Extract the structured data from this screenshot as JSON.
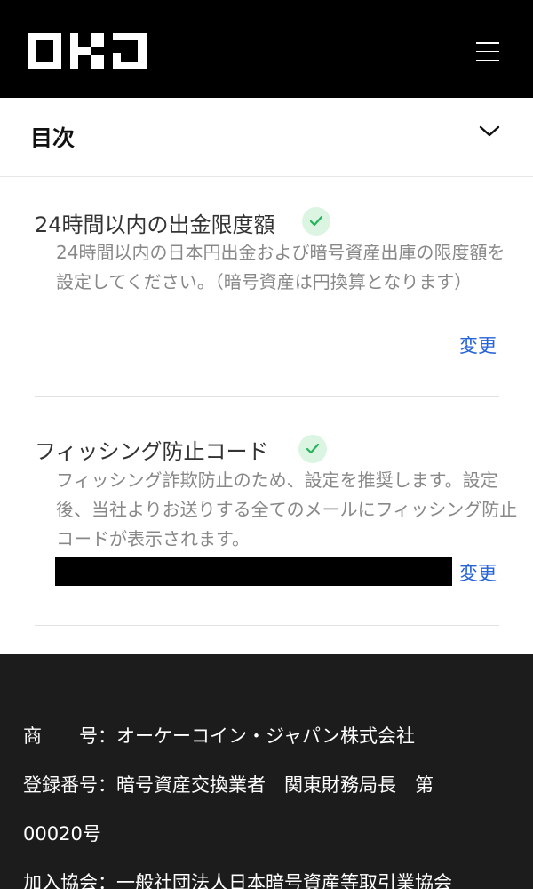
{
  "header": {
    "logo_text": "OKJ",
    "menu_icon": "hamburger-menu-icon"
  },
  "toc": {
    "title": "目次",
    "chevron_icon": "chevron-down-icon"
  },
  "sections": [
    {
      "title": "24時間以内の出金限度額",
      "status_icon": "check-icon",
      "description": "24時間以内の日本円出金および暗号資産出庫の限度額を設定してください。（暗号資産は円換算となります）",
      "action_label": "変更"
    },
    {
      "title": "フィッシング防止コード",
      "status_icon": "check-icon",
      "description": "フィッシング詐欺防止のため、設定を推奨します。設定後、当社よりお送りする全てのメールにフィッシング防止コードが表示されます。",
      "action_label": "変更"
    }
  ],
  "footer": {
    "company": "商　　号：オーケーコイン・ジャパン株式会社",
    "registration_1": "登録番号：暗号資産交換業者　関東財務局長　第",
    "registration_2": "00020号",
    "association": "加入協会：一般社団法人日本暗号資産等取引業協会"
  },
  "colors": {
    "header_bg": "#000000",
    "footer_bg": "#1c1c1c",
    "link": "#2563d9",
    "check_bg": "#dcf5e2",
    "check_mark": "#27b35a"
  }
}
